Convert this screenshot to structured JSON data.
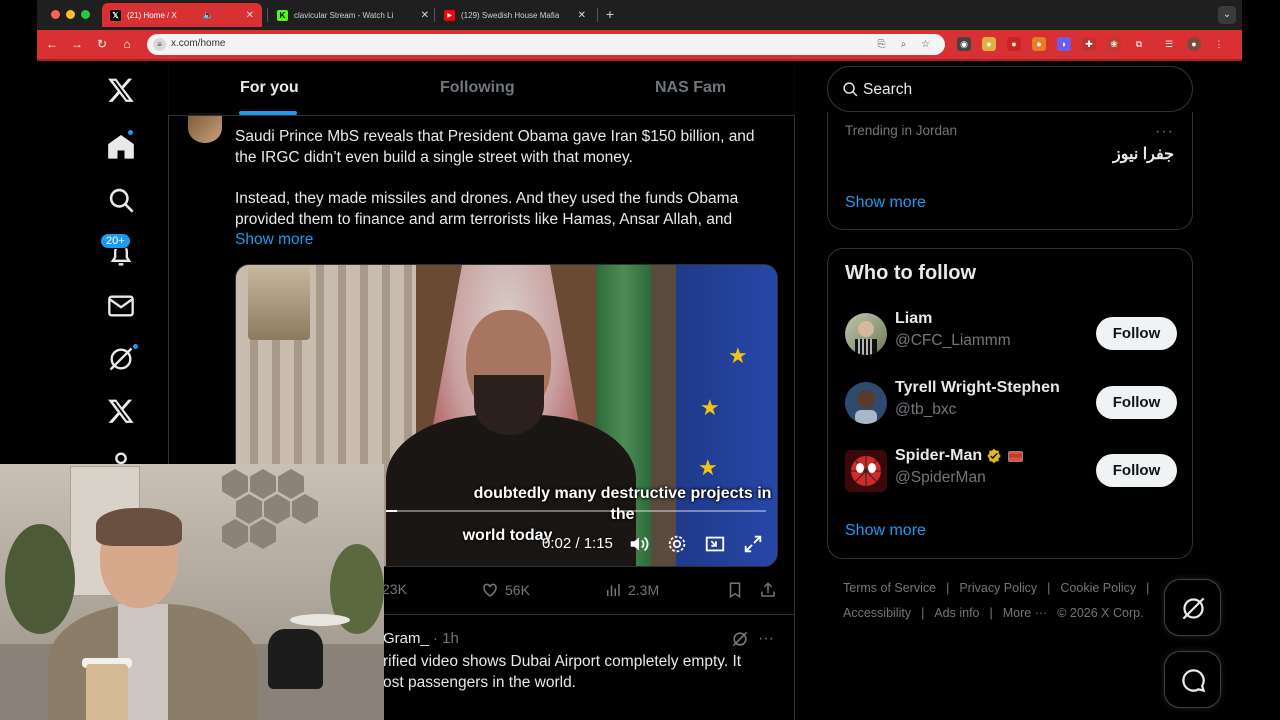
{
  "browser": {
    "tabs": [
      {
        "title": "(21) Home / X",
        "active": true
      },
      {
        "title": "clavicular Stream - Watch Li",
        "active": false
      },
      {
        "title": "(129) Swedish House Mafia",
        "active": false
      }
    ],
    "url": "x.com/home",
    "accent_color": "#d93034"
  },
  "leftnav": {
    "notifications_badge": "20+"
  },
  "feed": {
    "tabs": [
      {
        "label": "For you",
        "active": true
      },
      {
        "label": "Following",
        "active": false
      },
      {
        "label": "NAS Fam",
        "active": false
      }
    ],
    "tweet1": {
      "para1_line1": "Saudi Prince MbS reveals that President Obama gave Iran $150 billion, and",
      "para1_line2": "the IRGC didn’t even build a single street with that money.",
      "para2_line1": "Instead, they made missiles and drones. And they used the funds Obama",
      "para2_line2": "provided them to finance and arm terrorists like Hamas, Ansar Allah, and",
      "show_more": "Show more",
      "video": {
        "caption_line1": "doubtedly many destructive projects in the",
        "caption_line2": "world today",
        "time": "0:02 / 1:15",
        "progress": 0.03
      },
      "stats": {
        "reposts": "23K",
        "likes": "56K",
        "views": "2.3M"
      }
    },
    "tweet2": {
      "handle": "Gram_",
      "time": " · 1h",
      "line1": "rified video shows Dubai Airport completely empty. It",
      "line2": "ost passengers in the world."
    }
  },
  "right": {
    "search_placeholder": "Search",
    "trend": {
      "meta": "Trending in Jordan",
      "name": "جفرا نيوز",
      "more": "···",
      "show_more": "Show more"
    },
    "who_to_follow": {
      "title": "Who to follow",
      "users": [
        {
          "name": "Liam",
          "handle": "@CFC_Liammm",
          "button": "Follow"
        },
        {
          "name": "Tyrell Wright-Stephen",
          "handle": "@tb_bxc",
          "button": "Follow"
        },
        {
          "name": "Spider-Man",
          "handle": "@SpiderMan",
          "button": "Follow"
        }
      ],
      "show_more": "Show more"
    },
    "footer": {
      "row1": [
        "Terms of Service",
        "Privacy Policy",
        "Cookie Policy"
      ],
      "row2": [
        "Accessibility",
        "Ads info",
        "More ···",
        "© 2026 X Corp."
      ]
    }
  },
  "icons": {
    "nav": [
      "x-logo-icon",
      "home-icon",
      "search-icon",
      "bell-icon",
      "mail-icon",
      "grok-icon",
      "x-premium-icon",
      "profile-icon"
    ],
    "fab": [
      "grok-icon",
      "chat-icon"
    ]
  }
}
